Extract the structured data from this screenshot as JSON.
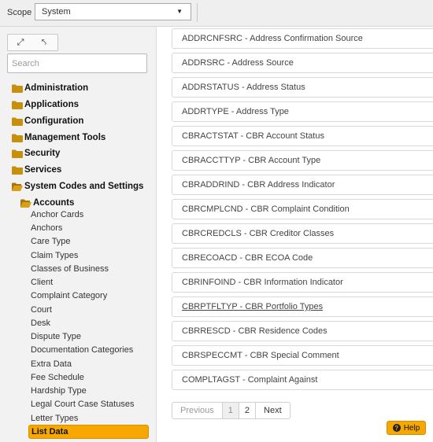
{
  "topbar": {
    "scope_label": "Scope",
    "scope_value": "System"
  },
  "leftpanel": {
    "search_placeholder": "Search",
    "folders": [
      {
        "label": "Administration",
        "icon": "folder-icon"
      },
      {
        "label": "Applications",
        "icon": "folder-icon"
      },
      {
        "label": "Configuration",
        "icon": "folder-icon"
      },
      {
        "label": "Management Tools",
        "icon": "folder-icon"
      },
      {
        "label": "Security",
        "icon": "folder-icon"
      },
      {
        "label": "Services",
        "icon": "folder-icon"
      },
      {
        "label": "System Codes and Settings",
        "icon": "folder-open-icon"
      },
      {
        "label": "Accounts",
        "icon": "folder-open-icon"
      }
    ],
    "leaves": [
      "Anchor Cards",
      "Anchors",
      "Care Type",
      "Claim Types",
      "Classes of Business",
      "Client",
      "Complaint Category",
      "Court",
      "Desk",
      "Dispute Type",
      "Documentation Categories",
      "Extra Data",
      "Fee Schedule",
      "Hardship Type",
      "Legal Court Case Statuses",
      "Letter Types",
      "List Data"
    ],
    "active_leaf": "List Data"
  },
  "list": {
    "items": [
      "ADDRCNFSRC - Address Confirmation Source",
      "ADDRSRC - Address Source",
      "ADDRSTATUS - Address Status",
      "ADDRTYPE - Address Type",
      "CBRACTSTAT - CBR Account Status",
      "CBRACCTTYP - CBR Account Type",
      "CBRADDRIND - CBR Address Indicator",
      "CBRCMPLCND - CBR Complaint Condition",
      "CBRCREDCLS - CBR Creditor Classes",
      "CBRECOACD - CBR ECOA Code",
      "CBRINFOIND - CBR Information Indicator",
      "CBRPTFLTYP - CBR Portfolio Types",
      "CBRRESCD - CBR Residence Codes",
      "CBRSPECCMT - CBR Special Comment",
      "COMPLTAGST - Complaint Against"
    ],
    "hovered_item": "CBRPTFLTYP - CBR Portfolio Types"
  },
  "pagination": {
    "previous": "Previous",
    "page1": "1",
    "page2": "2",
    "next": "Next",
    "current_page": 1
  },
  "help": {
    "label": "Help",
    "icon": "question-icon"
  },
  "colors": {
    "accent": "#f6a800",
    "folder": "#c8900a"
  }
}
